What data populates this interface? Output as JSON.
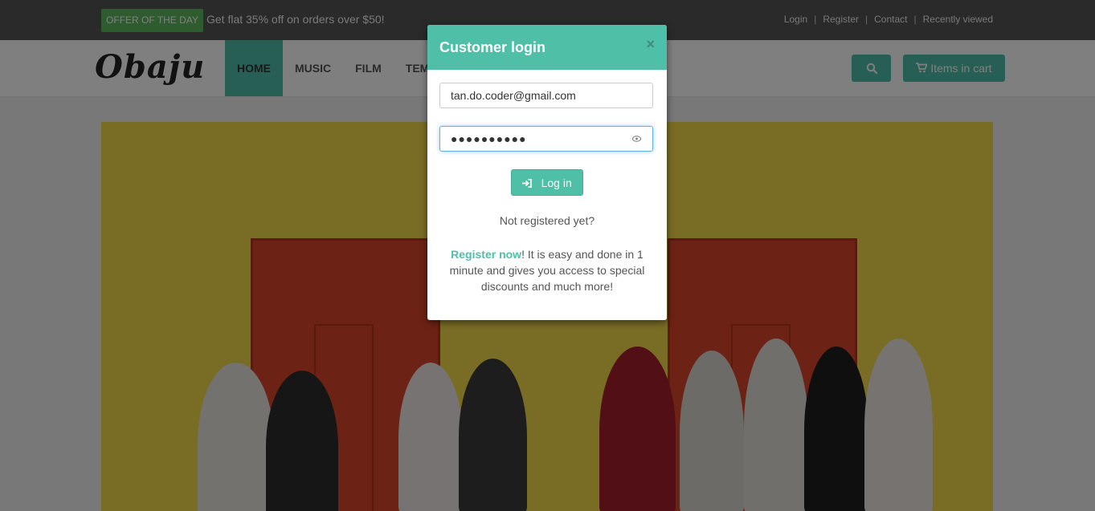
{
  "topbar": {
    "offer_badge": "OFFER OF THE DAY",
    "offer_text": "Get flat 35% off on orders over $50!",
    "links": [
      "Login",
      "Register",
      "Contact",
      "Recently viewed"
    ]
  },
  "navbar": {
    "logo": "Obaju",
    "items": [
      "HOME",
      "MUSIC",
      "FILM",
      "TEMP"
    ],
    "cart_label": "Items in cart"
  },
  "modal": {
    "title": "Customer login",
    "close": "×",
    "email_value": "tan.do.coder@gmail.com",
    "password_value": "●●●●●●●●●●",
    "login_label": "Log in",
    "not_registered": "Not registered yet?",
    "register_link": "Register now",
    "register_text": "! It is easy and done in 1 minute and gives you access to special discounts and much more!"
  },
  "colors": {
    "accent": "#4fbfa8",
    "offer_green": "#5cb85c",
    "banner_yellow": "#f3d84a",
    "door_red": "#d9442a"
  },
  "icons": {
    "search": "search-icon",
    "cart": "cart-icon",
    "close": "close-icon",
    "login": "sign-in-icon",
    "eye": "eye-icon"
  }
}
